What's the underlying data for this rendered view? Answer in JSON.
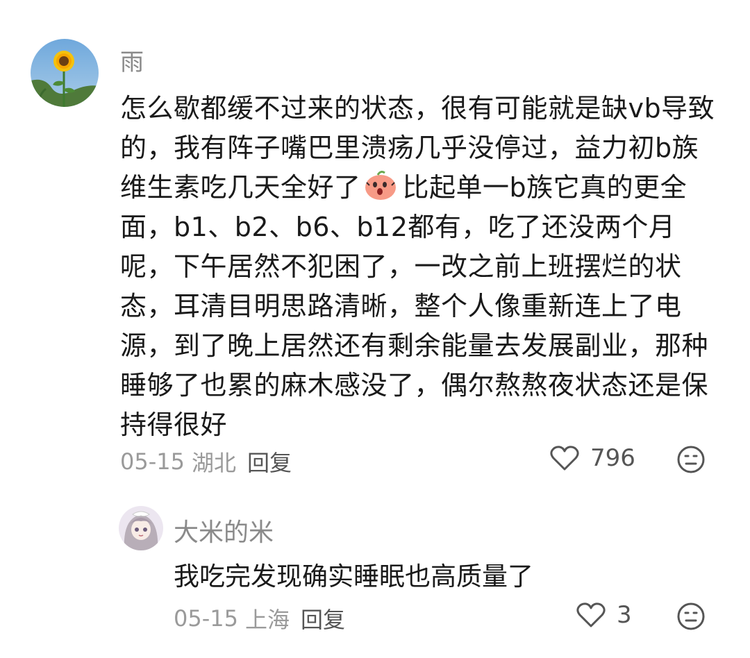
{
  "comments": [
    {
      "username": "雨",
      "text_line1": "怎么歇都缓不过来的状态，很有可能就是缺vb导致的，我有阵子嘴巴里溃疡几乎没停过，益力初b族维生素吃几天全好了",
      "text_line2": "比起单一b族它真的更全面，b1、b2、b6、b12都有，吃了还没两个月呢，下午居然不犯困了，一改之前上班摆烂的状态，耳清目明思路清晰，整个人像重新连上了电源，到了晚上居然还有剩余能量去发展副业，那种睡够了也累的麻木感没了，偶尔熬熬夜状态还是保持得很好",
      "date": "05-15",
      "location": "湖北",
      "reply_label": "回复",
      "likes": "796",
      "avatar_icon": "sunflower-avatar",
      "emoji_icon": "surprised-peach-emoji"
    },
    {
      "username": "大米的米",
      "text": "我吃完发现确实睡眠也高质量了",
      "date": "05-15",
      "location": "上海",
      "reply_label": "回复",
      "likes": "3",
      "avatar_icon": "anime-girl-avatar"
    }
  ],
  "icons": {
    "like": "heart-outline-icon",
    "dislike": "neutral-face-icon"
  },
  "colors": {
    "text": "#1a1a1a",
    "username": "#8a8a8a",
    "meta": "#9a9a9a",
    "icon": "#555555"
  }
}
